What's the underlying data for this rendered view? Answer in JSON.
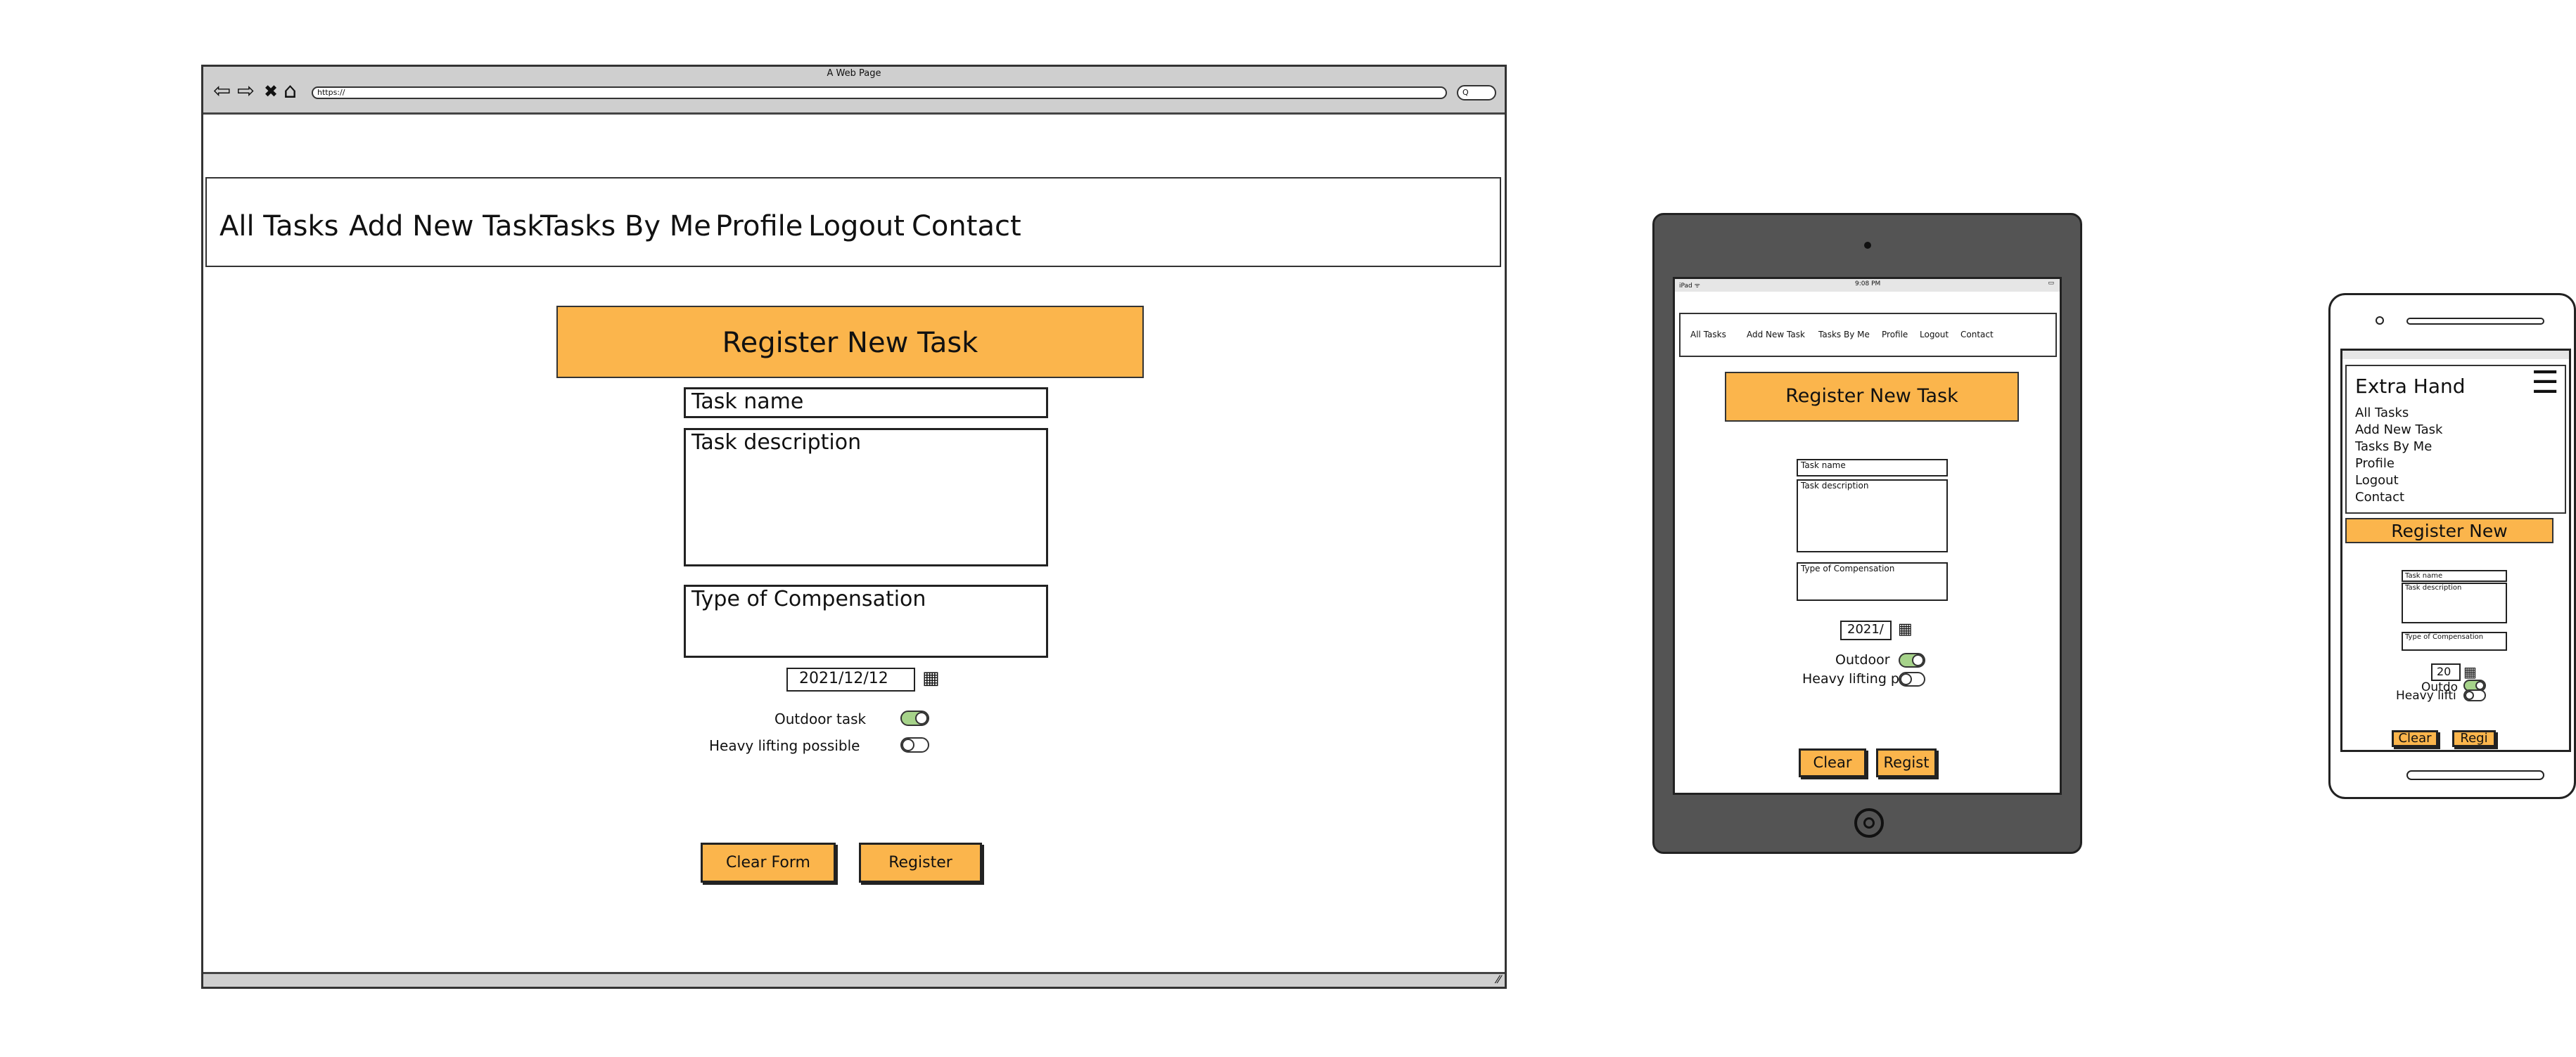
{
  "browser": {
    "title": "A Web Page",
    "url": "https://",
    "search_placeholder": "Q",
    "nav_glyphs": {
      "back": "⇦",
      "forward": "⇨",
      "stop": "✖",
      "home": "⌂"
    },
    "grip": "⁄⁄"
  },
  "nav": {
    "items": [
      "All Tasks",
      "Add New Task",
      "Tasks By Me",
      "Profile",
      "Logout",
      "Contact"
    ]
  },
  "form": {
    "title": "Register New Task",
    "task_name_placeholder": "Task name",
    "task_description_placeholder": "Task description",
    "compensation_placeholder": "Type of Compensation",
    "date_value": "2021/12/12",
    "outdoor_label": "Outdoor task",
    "outdoor_on": true,
    "heavy_label": "Heavy lifting possible",
    "heavy_on": false,
    "clear_label": "Clear Form",
    "register_label": "Register"
  },
  "tablet": {
    "status_left": "iPad ᯤ",
    "status_time": "9:08 PM",
    "status_right": "▭",
    "title": "Register New Task",
    "date_value": "2021/",
    "outdoor_label": "Outdoor",
    "heavy_label": "Heavy lifting p",
    "clear_label": "Clear",
    "register_label": "Regist"
  },
  "phone": {
    "brand": "Extra Hand",
    "menu_icon": "☰",
    "title": "Register New",
    "date_value": "20",
    "outdoor_label": "Outdo",
    "heavy_label": "Heavy lifti",
    "clear_label": "Clear",
    "register_label": "Regi"
  },
  "icons": {
    "calendar": "▦"
  },
  "colors": {
    "accent": "#fbb54c",
    "toggle_on": "#a6d38a",
    "device_body": "#545454"
  }
}
